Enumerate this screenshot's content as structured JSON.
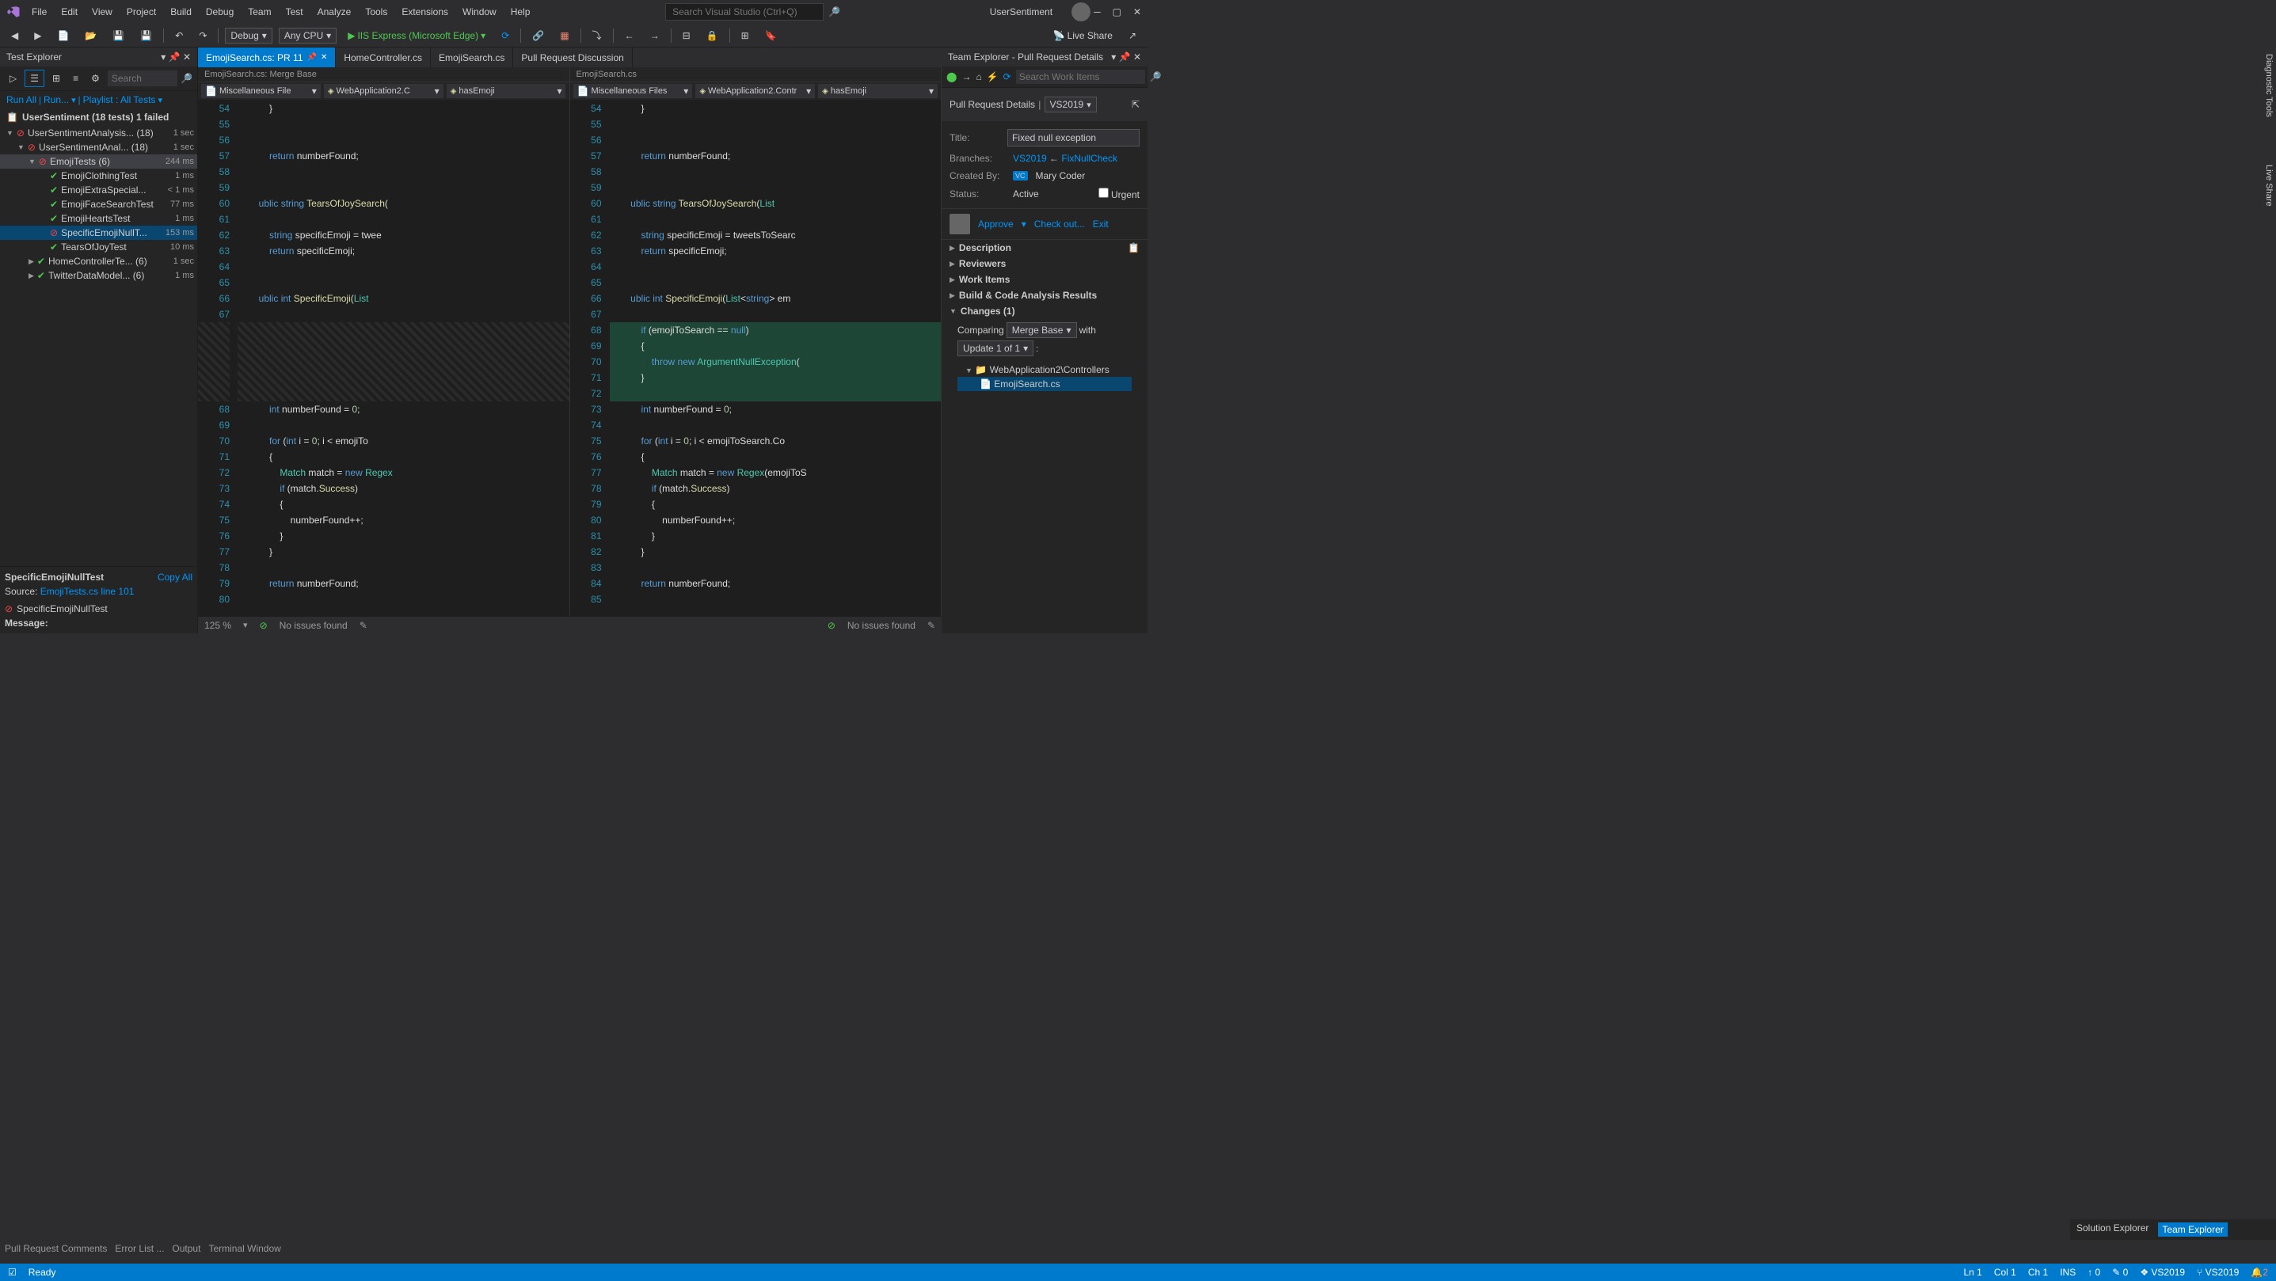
{
  "titlebar": {
    "menu": [
      "File",
      "Edit",
      "View",
      "Project",
      "Build",
      "Debug",
      "Team",
      "Test",
      "Analyze",
      "Tools",
      "Extensions",
      "Window",
      "Help"
    ],
    "search_placeholder": "Search Visual Studio (Ctrl+Q)",
    "solution": "UserSentiment"
  },
  "toolbar": {
    "config": "Debug",
    "platform": "Any CPU",
    "launch": "IIS Express (Microsoft Edge)",
    "live_share": "Live Share"
  },
  "test_explorer": {
    "title": "Test Explorer",
    "search_placeholder": "Search",
    "links": {
      "run_all": "Run All",
      "run": "Run...",
      "playlist": "Playlist : All Tests"
    },
    "summary": "UserSentiment (18 tests) 1 failed",
    "tree": [
      {
        "indent": 0,
        "status": "fail",
        "name": "UserSentimentAnalysis... (18)",
        "dur": "1 sec",
        "caret": "▼"
      },
      {
        "indent": 1,
        "status": "fail",
        "name": "UserSentimentAnal... (18)",
        "dur": "1 sec",
        "caret": "▼"
      },
      {
        "indent": 2,
        "status": "fail",
        "name": "EmojiTests (6)",
        "dur": "244 ms",
        "caret": "▼",
        "hl": true
      },
      {
        "indent": 3,
        "status": "pass",
        "name": "EmojiClothingTest",
        "dur": "1 ms"
      },
      {
        "indent": 3,
        "status": "pass",
        "name": "EmojiExtraSpecial...",
        "dur": "< 1 ms"
      },
      {
        "indent": 3,
        "status": "pass",
        "name": "EmojiFaceSearchTest",
        "dur": "77 ms"
      },
      {
        "indent": 3,
        "status": "pass",
        "name": "EmojiHeartsTest",
        "dur": "1 ms"
      },
      {
        "indent": 3,
        "status": "fail",
        "name": "SpecificEmojiNullT...",
        "dur": "153 ms",
        "sel": true
      },
      {
        "indent": 3,
        "status": "pass",
        "name": "TearsOfJoyTest",
        "dur": "10 ms"
      },
      {
        "indent": 2,
        "status": "pass",
        "name": "HomeControllerTe... (6)",
        "dur": "1 sec",
        "caret": "▶"
      },
      {
        "indent": 2,
        "status": "pass",
        "name": "TwitterDataModel... (6)",
        "dur": "1 ms",
        "caret": "▶"
      }
    ],
    "detail": {
      "title": "SpecificEmojiNullTest",
      "copy": "Copy All",
      "source_label": "Source:",
      "source_link": "EmojiTests.cs line 101",
      "fail_name": "SpecificEmojiNullTest",
      "msg_label": "Message:"
    }
  },
  "editor": {
    "tabs": [
      {
        "label": "EmojiSearch.cs: PR 11",
        "active": true,
        "pinned": true,
        "closable": true
      },
      {
        "label": "HomeController.cs"
      },
      {
        "label": "EmojiSearch.cs"
      },
      {
        "label": "Pull Request Discussion"
      }
    ],
    "left_pane": {
      "title": "EmojiSearch.cs: Merge Base",
      "nav": [
        "Miscellaneous File",
        "WebApplication2.C",
        "hasEmoji"
      ],
      "lines": [
        {
          "n": 54,
          "t": "            }"
        },
        {
          "n": 55,
          "t": ""
        },
        {
          "n": 56,
          "t": ""
        },
        {
          "n": 57,
          "t": "            return numberFound;"
        },
        {
          "n": 58,
          "t": ""
        },
        {
          "n": 59,
          "t": ""
        },
        {
          "n": 60,
          "t": "        ublic string TearsOfJoySearch("
        },
        {
          "n": 61,
          "t": ""
        },
        {
          "n": 62,
          "t": "            string specificEmoji = twee"
        },
        {
          "n": 63,
          "t": "            return specificEmoji;"
        },
        {
          "n": 64,
          "t": ""
        },
        {
          "n": 65,
          "t": ""
        },
        {
          "n": 66,
          "t": "        ublic int SpecificEmoji(List<s"
        },
        {
          "n": 67,
          "t": ""
        }
      ],
      "lines2": [
        {
          "n": 68,
          "t": "            int numberFound = 0;"
        },
        {
          "n": 69,
          "t": ""
        },
        {
          "n": 70,
          "t": "            for (int i = 0; i < emojiTo"
        },
        {
          "n": 71,
          "t": "            {"
        },
        {
          "n": 72,
          "t": "                Match match = new Regex"
        },
        {
          "n": 73,
          "t": "                if (match.Success)"
        },
        {
          "n": 74,
          "t": "                {"
        },
        {
          "n": 75,
          "t": "                    numberFound++;"
        },
        {
          "n": 76,
          "t": "                }"
        },
        {
          "n": 77,
          "t": "            }"
        },
        {
          "n": 78,
          "t": ""
        },
        {
          "n": 79,
          "t": "            return numberFound;"
        },
        {
          "n": 80,
          "t": ""
        }
      ]
    },
    "right_pane": {
      "title": "EmojiSearch.cs",
      "nav": [
        "Miscellaneous Files",
        "WebApplication2.Contr",
        "hasEmoji"
      ],
      "lines": [
        {
          "n": 54,
          "t": "            }"
        },
        {
          "n": 55,
          "t": ""
        },
        {
          "n": 56,
          "t": ""
        },
        {
          "n": 57,
          "t": "            return numberFound;"
        },
        {
          "n": 58,
          "t": ""
        },
        {
          "n": 59,
          "t": ""
        },
        {
          "n": 60,
          "t": "        ublic string TearsOfJoySearch(List<stri"
        },
        {
          "n": 61,
          "t": ""
        },
        {
          "n": 62,
          "t": "            string specificEmoji = tweetsToSearc"
        },
        {
          "n": 63,
          "t": "            return specificEmoji;"
        },
        {
          "n": 64,
          "t": ""
        },
        {
          "n": 65,
          "t": ""
        },
        {
          "n": 66,
          "t": "        ublic int SpecificEmoji(List<string> em"
        },
        {
          "n": 67,
          "t": ""
        },
        {
          "n": 68,
          "t": "            if (emojiToSearch == null)",
          "add": true
        },
        {
          "n": 69,
          "t": "            {",
          "add": true
        },
        {
          "n": 70,
          "t": "                throw new ArgumentNullException(",
          "add": true
        },
        {
          "n": 71,
          "t": "            }",
          "add": true
        },
        {
          "n": 72,
          "t": "",
          "add": true
        },
        {
          "n": 73,
          "t": "            int numberFound = 0;"
        },
        {
          "n": 74,
          "t": ""
        },
        {
          "n": 75,
          "t": "            for (int i = 0; i < emojiToSearch.Co"
        },
        {
          "n": 76,
          "t": "            {"
        },
        {
          "n": 77,
          "t": "                Match match = new Regex(emojiToS"
        },
        {
          "n": 78,
          "t": "                if (match.Success)"
        },
        {
          "n": 79,
          "t": "                {"
        },
        {
          "n": 80,
          "t": "                    numberFound++;"
        },
        {
          "n": 81,
          "t": "                }"
        },
        {
          "n": 82,
          "t": "            }"
        },
        {
          "n": 83,
          "t": ""
        },
        {
          "n": 84,
          "t": "            return numberFound;"
        },
        {
          "n": 85,
          "t": ""
        }
      ]
    },
    "status": {
      "zoom": "125 %",
      "issues": "No issues found"
    }
  },
  "team_explorer": {
    "title": "Team Explorer - Pull Request Details",
    "search_placeholder": "Search Work Items",
    "heading": "Pull Request Details",
    "branch_dd": "VS2019",
    "fields": {
      "title_label": "Title:",
      "title_value": "Fixed null exception",
      "branches_label": "Branches:",
      "branch_target": "VS2019",
      "branch_source": "FixNullCheck",
      "created_label": "Created By:",
      "created_by": "Mary Coder",
      "badge": "VC",
      "status_label": "Status:",
      "status_value": "Active",
      "urgent": "Urgent"
    },
    "actions": {
      "approve": "Approve",
      "checkout": "Check out...",
      "exit": "Exit"
    },
    "sections": [
      "Description",
      "Reviewers",
      "Work Items",
      "Build & Code Analysis Results"
    ],
    "changes": {
      "label": "Changes (1)",
      "comparing": "Comparing",
      "merge_base": "Merge Base",
      "with": "with",
      "update": "Update 1 of 1",
      "folder": "WebApplication2\\Controllers",
      "file": "EmojiSearch.cs"
    },
    "tabs": {
      "sol": "Solution Explorer",
      "team": "Team Explorer"
    }
  },
  "bottom_tabs": [
    "Pull Request Comments",
    "Error List ...",
    "Output",
    "Terminal Window"
  ],
  "statusbar": {
    "ready": "Ready",
    "ln": "Ln 1",
    "col": "Col 1",
    "ch": "Ch 1",
    "ins": "INS",
    "up": "0",
    "pen": "0",
    "branch1": "VS2019",
    "branch2": "VS2019",
    "notif": "2"
  },
  "side_tabs": {
    "diag": "Diagnostic Tools",
    "live": "Live Share"
  }
}
